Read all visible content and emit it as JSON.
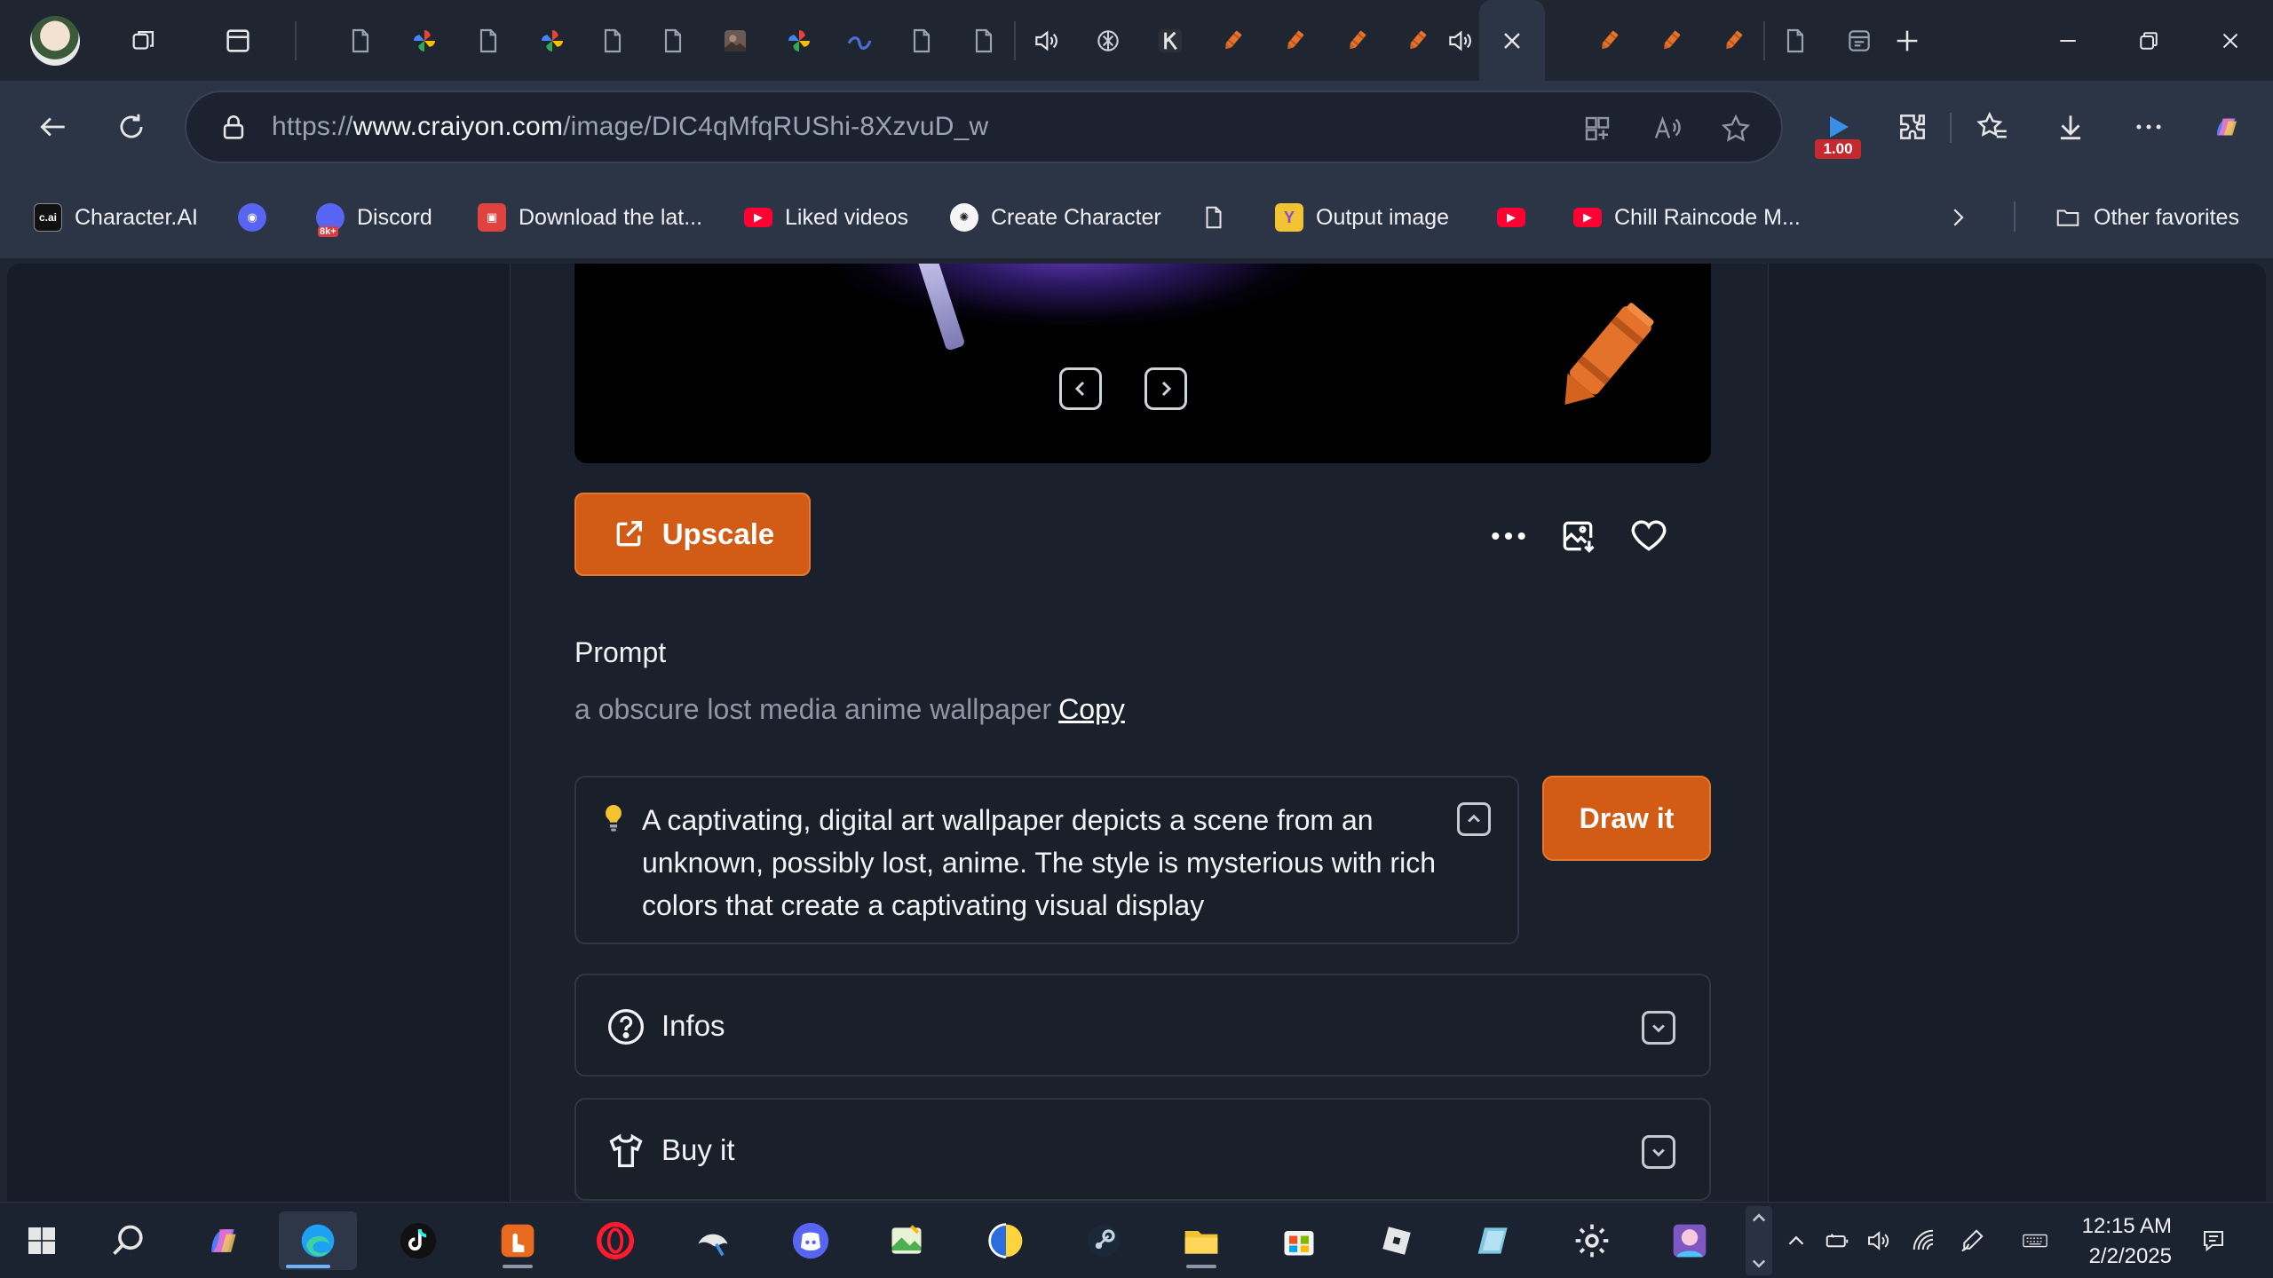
{
  "browser": {
    "tabs": [
      {
        "name": "tab-generic",
        "icon": "page-icon"
      },
      {
        "name": "tab-pinwheel",
        "icon": "pinwheel-icon"
      },
      {
        "name": "tab-generic",
        "icon": "page-icon"
      },
      {
        "name": "tab-pinwheel",
        "icon": "pinwheel-icon"
      },
      {
        "name": "tab-generic",
        "icon": "page-icon"
      },
      {
        "name": "tab-generic",
        "icon": "page-icon"
      },
      {
        "name": "tab-thumbnail",
        "icon": "image-thumb-icon"
      },
      {
        "name": "tab-pinwheel",
        "icon": "pinwheel-icon"
      },
      {
        "name": "tab-swirl",
        "icon": "swirl-icon"
      },
      {
        "name": "tab-generic",
        "icon": "page-icon"
      },
      {
        "name": "tab-generic",
        "icon": "page-icon"
      },
      {
        "name": "tab-audio",
        "icon": "speaker-icon"
      },
      {
        "name": "tab-openai",
        "icon": "openai-icon"
      },
      {
        "name": "tab-k",
        "icon": "k-logo-icon"
      },
      {
        "name": "tab-craiyon",
        "icon": "crayon-icon"
      },
      {
        "name": "tab-craiyon",
        "icon": "crayon-icon"
      },
      {
        "name": "tab-craiyon",
        "icon": "crayon-icon"
      },
      {
        "name": "tab-craiyon",
        "icon": "crayon-icon"
      },
      {
        "name": "tab-audio",
        "icon": "speaker-icon"
      },
      {
        "name": "tab-active",
        "icon": "close-icon"
      },
      {
        "name": "tab-craiyon",
        "icon": "crayon-icon"
      },
      {
        "name": "tab-craiyon",
        "icon": "crayon-icon"
      },
      {
        "name": "tab-craiyon",
        "icon": "crayon-icon"
      },
      {
        "name": "tab-generic",
        "icon": "page-icon"
      },
      {
        "name": "tab-app",
        "icon": "app-icon"
      }
    ],
    "url_prefix": "https://",
    "url_host": "www.craiyon.com",
    "url_path": "/image/DIC4qMfqRUShi-8XzvuD_w",
    "extension_badge": "1.00",
    "accent": "#d25b16"
  },
  "bookmarks": [
    {
      "label": "Character.AI",
      "icon": "characterai-icon"
    },
    {
      "label": "",
      "icon": "discord-icon"
    },
    {
      "label": "Discord",
      "icon": "discord-8k-icon",
      "badge": "8k+"
    },
    {
      "label": "Download the lat...",
      "icon": "store-icon"
    },
    {
      "label": "Liked videos",
      "icon": "youtube-icon"
    },
    {
      "label": "Create Character",
      "icon": "openai-icon"
    },
    {
      "label": "",
      "icon": "page-icon"
    },
    {
      "label": "Output image",
      "icon": "y-icon"
    },
    {
      "label": "",
      "icon": "youtube-icon"
    },
    {
      "label": "Chill Raincode M...",
      "icon": "youtube-icon"
    },
    {
      "label": "Other favorites",
      "icon": "folder-icon"
    }
  ],
  "page": {
    "upscale_label": "Upscale",
    "prompt_label": "Prompt",
    "prompt_text": "a obscure lost media anime wallpaper",
    "copy_label": "Copy",
    "description": "A captivating, digital art wallpaper depicts a scene from an unknown, possibly lost, anime. The style is mysterious with rich colors that create a captivating visual display",
    "draw_label": "Draw it",
    "infos_label": "Infos",
    "buy_label": "Buy it"
  },
  "taskbar": {
    "apps": [
      {
        "name": "start",
        "icon": "windows-icon"
      },
      {
        "name": "search",
        "icon": "search-icon"
      },
      {
        "name": "copilot",
        "icon": "copilot-icon"
      },
      {
        "name": "edge",
        "icon": "edge-icon",
        "active": true
      },
      {
        "name": "tiktok",
        "icon": "tiktok-icon"
      },
      {
        "name": "app-orange",
        "icon": "orange-app-icon"
      },
      {
        "name": "opera",
        "icon": "opera-icon"
      },
      {
        "name": "app-paint",
        "icon": "paint-icon"
      },
      {
        "name": "discord",
        "icon": "discord-icon"
      },
      {
        "name": "app-image",
        "icon": "image-app-icon"
      },
      {
        "name": "app-blue",
        "icon": "globe-icon"
      },
      {
        "name": "steam",
        "icon": "steam-icon"
      },
      {
        "name": "file-explorer",
        "icon": "folder-icon"
      },
      {
        "name": "store",
        "icon": "store-icon"
      },
      {
        "name": "roblox",
        "icon": "roblox-icon"
      },
      {
        "name": "app-cyan",
        "icon": "cyan-app-icon"
      },
      {
        "name": "settings",
        "icon": "gear-icon"
      },
      {
        "name": "app-avatar",
        "icon": "avatar-icon"
      }
    ],
    "time": "12:15 AM",
    "date": "2/2/2025"
  }
}
